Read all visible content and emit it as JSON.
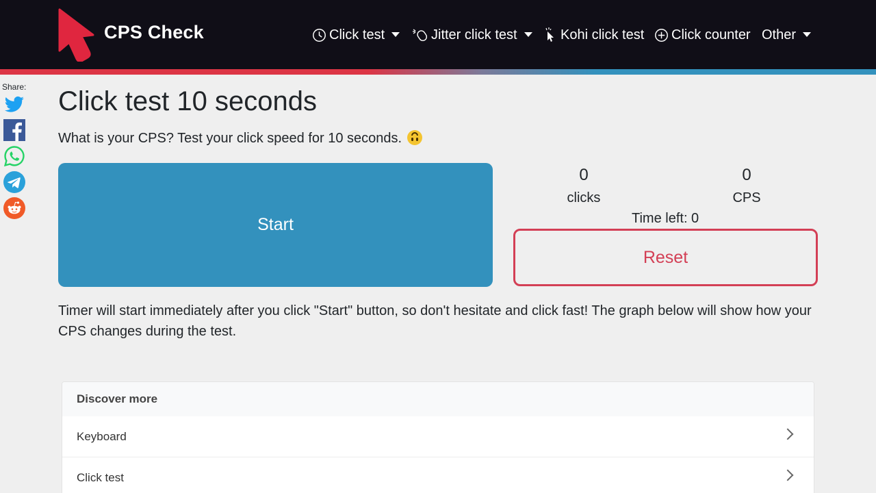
{
  "header": {
    "brand": "CPS Check",
    "nav": [
      {
        "label": "Click test",
        "icon": "clock-icon",
        "dropdown": true
      },
      {
        "label": "Jitter click test",
        "icon": "mouse-jitter-icon",
        "dropdown": true
      },
      {
        "label": "Kohi click test",
        "icon": "cursor-click-icon",
        "dropdown": false
      },
      {
        "label": "Click counter",
        "icon": "plus-circle-icon",
        "dropdown": false
      },
      {
        "label": "Other",
        "icon": "",
        "dropdown": true
      }
    ]
  },
  "share": {
    "label": "Share:",
    "items": [
      "twitter-icon",
      "facebook-icon",
      "whatsapp-icon",
      "telegram-icon",
      "reddit-icon"
    ]
  },
  "main": {
    "title": "Click test 10 seconds",
    "subtitle": "What is your CPS? Test your click speed for 10 seconds.",
    "start_label": "Start",
    "reset_label": "Reset",
    "clicks_value": "0",
    "clicks_label": "clicks",
    "cps_value": "0",
    "cps_label": "CPS",
    "time_left": "Time left: 0",
    "description": "Timer will start immediately after you click \"Start\" button, so don't hesitate and click fast! The graph below will show how your CPS changes during the test."
  },
  "discover": {
    "heading": "Discover more",
    "items": [
      "Keyboard",
      "Click test"
    ]
  },
  "colors": {
    "navbar": "#100e17",
    "start": "#3391bd",
    "reset": "#d33f55",
    "brand_red": "#dc3545"
  }
}
